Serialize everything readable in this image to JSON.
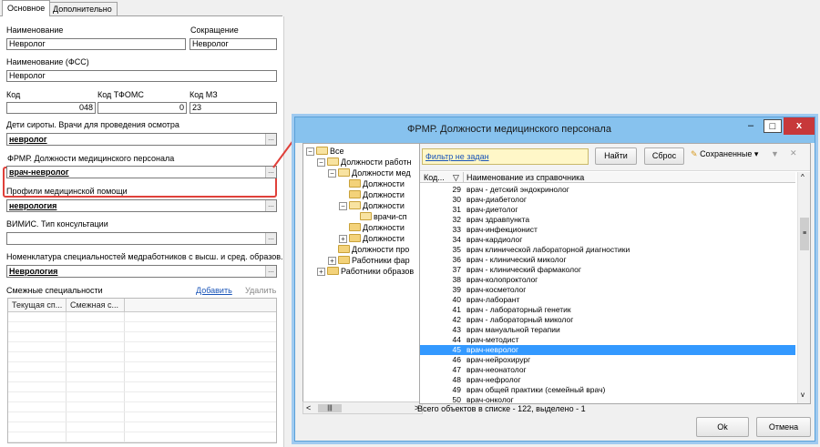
{
  "tabs": [
    {
      "label": "Основное",
      "active": true
    },
    {
      "label": "Дополнительно",
      "active": false
    }
  ],
  "form": {
    "name_label": "Наименование",
    "name_value": "Невролог",
    "abbr_label": "Сокращение",
    "abbr_value": "Невролог",
    "fss_label": "Наименование (ФСС)",
    "fss_value": "Невролог",
    "code_label": "Код",
    "code_value": "048",
    "tfoms_label": "Код ТФОМС",
    "tfoms_value": "0",
    "mz_label": "Код МЗ",
    "mz_value": "23",
    "orphans_label": "Дети сироты. Врачи для проведения осмотра",
    "orphans_value": "невролог",
    "frmr_label": "ФРМР. Должности медицинского персонала",
    "frmr_value": "врач-невролог",
    "profile_label": "Профили медицинской помощи",
    "profile_value": "неврология",
    "vimis_label": "ВИМИС. Тип консультации",
    "vimis_value": "",
    "nomen_label": "Номенклатура специальностей медработников с высш. и сред. образов.",
    "nomen_value": "Неврология",
    "related_label": "Смежные специальности",
    "add_link": "Добавить",
    "delete_link": "Удалить",
    "grid_cols": [
      "Текущая сп...",
      "Смежная с..."
    ],
    "lookup_btn": "..."
  },
  "dialog": {
    "title": "ФРМР. Должности медицинского персонала",
    "minimize": "–",
    "maximize": "□",
    "close": "x",
    "tree": [
      "Все",
      "Должности работн",
      "Должности мед",
      "Должности",
      "Должности",
      "Должности",
      "врачи-сп",
      "Должности",
      "Должности",
      "Должности про",
      "Работники фар",
      "Работники образов"
    ],
    "filter": "Фильтр не задан",
    "find_btn": "Найти",
    "reset_btn": "Сброс",
    "saved_btn": "Сохраненные",
    "col_code": "Код...",
    "col_name": "Наименование из справочника",
    "rows": [
      {
        "code": "29",
        "name": "врач - детский эндокринолог"
      },
      {
        "code": "30",
        "name": "врач-диабетолог"
      },
      {
        "code": "31",
        "name": "врач-диетолог"
      },
      {
        "code": "32",
        "name": "врач здравпункта"
      },
      {
        "code": "33",
        "name": "врач-инфекционист"
      },
      {
        "code": "34",
        "name": "врач-кардиолог"
      },
      {
        "code": "35",
        "name": "врач клинической лабораторной диагностики"
      },
      {
        "code": "36",
        "name": "врач - клинический миколог"
      },
      {
        "code": "37",
        "name": "врач - клинический фармаколог"
      },
      {
        "code": "38",
        "name": "врач-колопроктолог"
      },
      {
        "code": "39",
        "name": "врач-косметолог"
      },
      {
        "code": "40",
        "name": "врач-лаборант"
      },
      {
        "code": "41",
        "name": "врач - лабораторный генетик"
      },
      {
        "code": "42",
        "name": "врач - лабораторный миколог"
      },
      {
        "code": "43",
        "name": "врач мануальной терапии"
      },
      {
        "code": "44",
        "name": "врач-методист"
      },
      {
        "code": "45",
        "name": "врач-невролог"
      },
      {
        "code": "46",
        "name": "врач-нейрохирург"
      },
      {
        "code": "47",
        "name": "врач-неонатолог"
      },
      {
        "code": "48",
        "name": "врач-нефролог"
      },
      {
        "code": "49",
        "name": "врач общей практики (семейный врач)"
      },
      {
        "code": "50",
        "name": "врач-онколог"
      }
    ],
    "selected_code": "45",
    "status": "Всего объектов в списке - 122, выделено - 1",
    "ok_btn": "Ok",
    "cancel_btn": "Отмена"
  },
  "colors": {
    "highlight": "#e0403a",
    "selection": "#3399ff",
    "titlebar": "#87c2ee",
    "link": "#1a55b8"
  }
}
